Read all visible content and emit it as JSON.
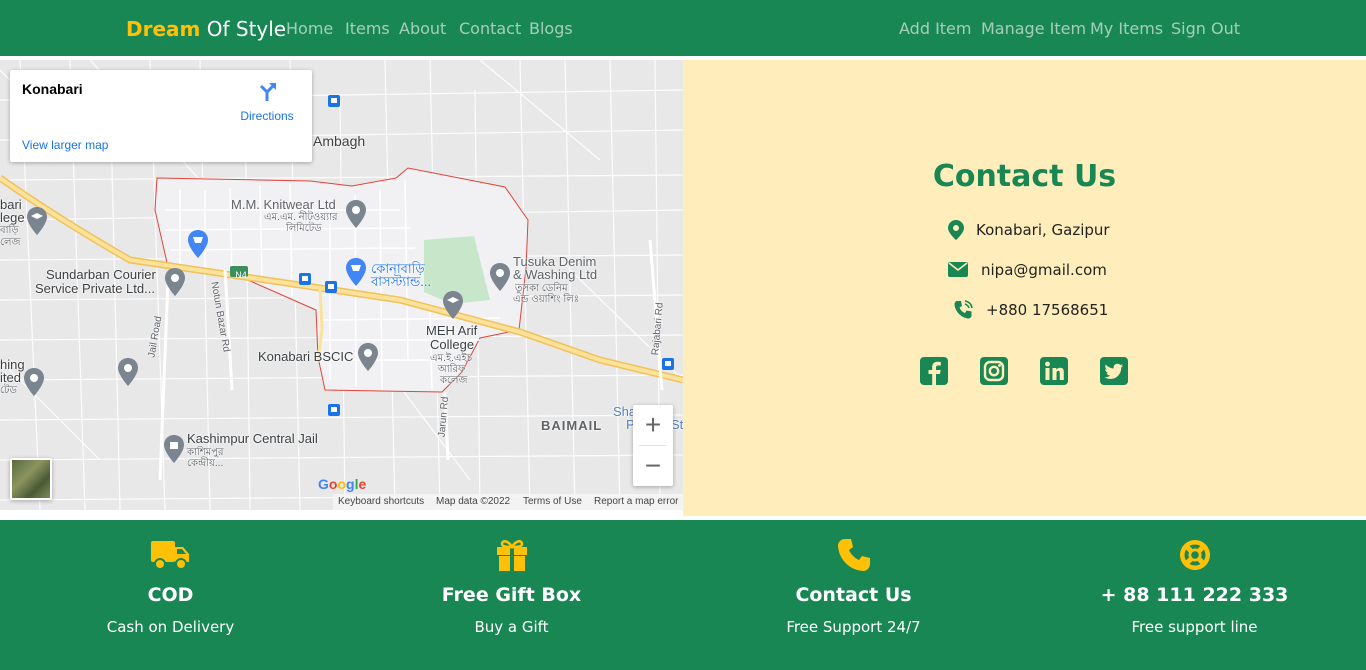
{
  "navbar": {
    "brand_highlight": "Dream",
    "brand_rest": " Of Style",
    "left_links": [
      "Home",
      "Items",
      "About",
      "Contact",
      "Blogs"
    ],
    "right_links": [
      "Add Item",
      "Manage Item",
      "My Items",
      "Sign Out"
    ]
  },
  "map": {
    "place_title": "Konabari",
    "directions_label": "Directions",
    "larger_map_link": "View larger map",
    "labels": {
      "ambagh": "Ambagh",
      "knitwear_1": "M.M. Knitwear Ltd",
      "knitwear_2": "এম.এম. নীটওয়্যার",
      "knitwear_3": "লিমিটেড",
      "busstand_1": "কোনাবাড়ি",
      "busstand_2": "বাসস্ট্যান্ড...",
      "tusuka_1": "Tusuka Denim",
      "tusuka_2": "& Washing Ltd",
      "tusuka_3": "তুসকা ডেনিম",
      "tusuka_4": "এন্ড ওয়াশিং লিঃ",
      "sundarban_1": "Sundarban Courier",
      "sundarban_2": "Service Private Ltd...",
      "bari_1": "bari",
      "bari_2": "lege",
      "bari_3": "বাড়ি",
      "bari_4": "লেজ",
      "road_n4": "N4",
      "jail_road": "Jail Road",
      "nutun_bazar": "Notun Bazar Rd",
      "jarun_rd": "Jarun Rd",
      "rajabari_rd": "Rajabari Rd",
      "meh_1": "MEH Arif",
      "meh_2": "College",
      "meh_3": "এম.ই.এইচ",
      "meh_4": "আরিফ",
      "meh_5": "কলেজ",
      "bscic": "Konabari BSCIC",
      "hing_1": "hing",
      "hing_2": "ited",
      "hing_3": "টেড",
      "jail_1": "Kashimpur Central Jail",
      "jail_2": "কাশিমপুর",
      "jail_3": "কেন্দ্রীয়...",
      "baimail": "BAIMAIL",
      "sha": "Sha",
      "p": "P",
      "sta": "Sta"
    },
    "zoom_in": "+",
    "zoom_out": "−",
    "google_logo": "Google",
    "attribution": {
      "shortcuts": "Keyboard shortcuts",
      "map_data": "Map data ©2022",
      "terms": "Terms of Use",
      "report": "Report a map error"
    }
  },
  "contact": {
    "title": "Contact Us",
    "address": "Konabari, Gazipur",
    "email": "nipa@gmail.com",
    "phone": "+880 17568651",
    "social_icons": [
      "facebook-icon",
      "instagram-icon",
      "linkedin-icon",
      "twitter-icon"
    ]
  },
  "features": [
    {
      "icon": "truck-icon",
      "title": "COD",
      "subtitle": "Cash on Delivery"
    },
    {
      "icon": "gift-icon",
      "title": "Free Gift Box",
      "subtitle": "Buy a Gift"
    },
    {
      "icon": "phone-icon",
      "title": "Contact Us",
      "subtitle": "Free Support 24/7"
    },
    {
      "icon": "lifebuoy-icon",
      "title": "+ 88 111 222 333",
      "subtitle": "Free support line"
    }
  ],
  "colors": {
    "primary": "#198754",
    "accent": "#ffc107",
    "contact_bg": "#ffeebb"
  }
}
